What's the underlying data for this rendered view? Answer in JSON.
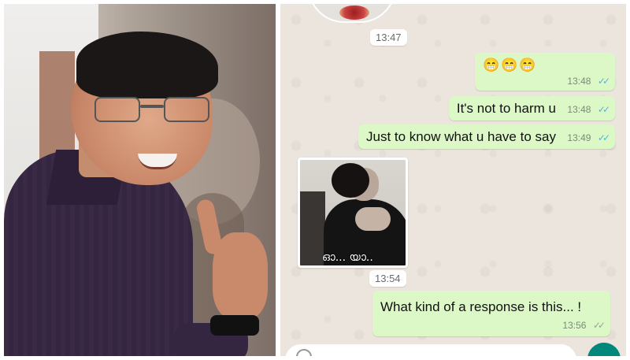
{
  "chat": {
    "time_1347": "13:47",
    "messages_out": [
      {
        "text": "😁😁😁",
        "time": "13:48"
      },
      {
        "text": "It's not to harm u",
        "time": "13:48"
      },
      {
        "text": "Just to know what u have to say",
        "time": "13:49"
      }
    ],
    "incoming_image": {
      "caption": "ഓ... യാ..",
      "time": "13:54"
    },
    "last_message": {
      "text": "What kind of a response is this... !",
      "time": "13:56"
    }
  },
  "icons": {
    "read_receipt": "double-check-icon",
    "delivered_receipt": "double-check-grey-icon",
    "emoji": "emoji-icon",
    "send": "send-icon"
  },
  "colors": {
    "outgoing_bubble": "#dcf8c6",
    "chat_background": "#ece5dd",
    "read_tick": "#4fb3f2",
    "send_button": "#00897b"
  }
}
